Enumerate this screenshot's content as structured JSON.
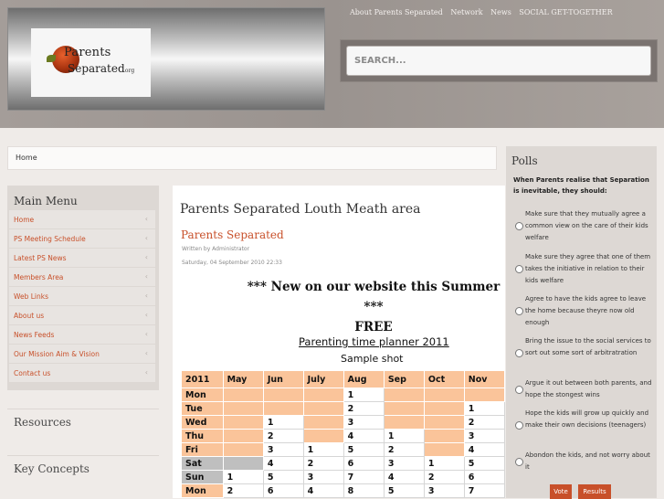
{
  "logo": {
    "line1": "Parents",
    "line2": "Separated",
    "suffix": ".org"
  },
  "topnav": [
    "About Parents Separated",
    "Network",
    "News",
    "SOCIAL GET-TOGETHER"
  ],
  "search": {
    "placeholder": "SEARCH..."
  },
  "breadcrumb": "Home",
  "main_menu": {
    "title": "Main Menu",
    "items": [
      "Home",
      "PS Meeting Schedule",
      "Latest PS News",
      "Members Area",
      "Web Links",
      "About us",
      "News Feeds",
      "Our Mission Aim & Vision",
      "Contact us"
    ]
  },
  "sidebar_sections": {
    "resources": "Resources",
    "key_concepts": "Key Concepts"
  },
  "content": {
    "area_title": "Parents Separated Louth Meath area",
    "article_title": "Parents Separated",
    "author": "Written by Administrator",
    "date": "Saturday, 04 September 2010 22:33",
    "headline_1": "*** New on our website this Summer ***",
    "headline_2": "FREE",
    "planner_title": "Parenting time planner 2011",
    "planner_sub": "Sample shot"
  },
  "planner": {
    "year": "2011",
    "months": [
      "May",
      "Jun",
      "July",
      "Aug",
      "Sep",
      "Oct",
      "Nov"
    ],
    "rows": [
      {
        "day": "Mon",
        "cells": [
          "",
          "",
          "",
          "1",
          "",
          "",
          ""
        ]
      },
      {
        "day": "Tue",
        "cells": [
          "",
          "",
          "",
          "2",
          "",
          "",
          "1"
        ]
      },
      {
        "day": "Wed",
        "cells": [
          "",
          "1",
          "",
          "3",
          "",
          "",
          "2"
        ]
      },
      {
        "day": "Thu",
        "cells": [
          "",
          "2",
          "",
          "4",
          "1",
          "",
          "3"
        ]
      },
      {
        "day": "Fri",
        "cells": [
          "",
          "3",
          "1",
          "5",
          "2",
          "",
          "4"
        ]
      },
      {
        "day": "Sat",
        "cells": [
          "",
          "4",
          "2",
          "6",
          "3",
          "1",
          "5"
        ]
      },
      {
        "day": "Sun",
        "cells": [
          "1",
          "5",
          "3",
          "7",
          "4",
          "2",
          "6"
        ]
      },
      {
        "day": "Mon",
        "cells": [
          "2",
          "6",
          "4",
          "8",
          "5",
          "3",
          "7"
        ]
      }
    ]
  },
  "polls": {
    "title": "Polls",
    "question": "When Parents realise that Separation is inevitable, they should:",
    "options": [
      "Make sure that they mutually agree a common view on the care of their kids welfare",
      "Make sure they agree that one of them takes the initiative in relation to their kids welfare",
      "Agree to have the kids agree to leave the home because theyre now old enough",
      "Bring the issue to the social services to sort out some sort of arbitratration",
      "Argue it out between both parents, and hope the stongest wins",
      "Hope the kids will grow up quickly and make their own decisions (teenagers)",
      "Abondon the kids, and not worry about it"
    ],
    "vote_label": "Vote",
    "results_label": "Results"
  },
  "colors": {
    "accent": "#c8502a",
    "planner_weekday": "#fac49a",
    "planner_weekend": "#bfbfbf"
  }
}
